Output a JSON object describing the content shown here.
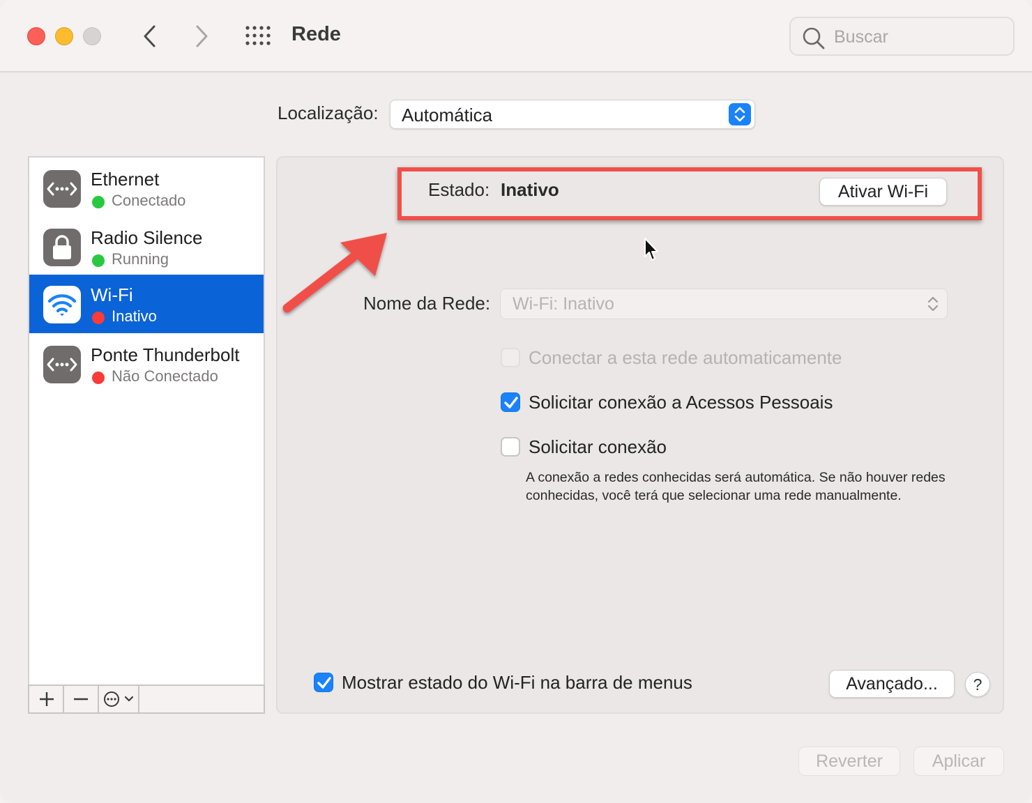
{
  "window": {
    "title": "Rede",
    "search_placeholder": "Buscar"
  },
  "location": {
    "label": "Localização:",
    "value": "Automática"
  },
  "services": [
    {
      "name": "Ethernet",
      "status": "Conectado",
      "status_color": "#28c941",
      "icon": "ethernet-icon"
    },
    {
      "name": "Radio Silence",
      "status": "Running",
      "status_color": "#28c941",
      "icon": "lock-icon"
    },
    {
      "name": "Wi-Fi",
      "status": "Inativo",
      "status_color": "#fb3b37",
      "icon": "wifi-icon",
      "selected": true
    },
    {
      "name": "Ponte Thunderbolt",
      "status": "Não Conectado",
      "status_color": "#fb3b37",
      "icon": "ethernet-icon"
    }
  ],
  "wifi": {
    "status_label": "Estado:",
    "status_value": "Inativo",
    "toggle_button": "Ativar Wi-Fi",
    "network_label": "Nome da Rede:",
    "network_value": "Wi-Fi: Inativo",
    "auto_join_label": "Conectar a esta rede automaticamente",
    "auto_join_checked": false,
    "ask_hotspot_label": "Solicitar conexão a Acessos Pessoais",
    "ask_hotspot_checked": true,
    "ask_join_label": "Solicitar conexão",
    "ask_join_checked": false,
    "ask_join_hint": "A conexão a redes conhecidas será automática. Se não houver redes conhecidas, você terá que selecionar uma rede manualmente.",
    "menubar_label": "Mostrar estado do Wi-Fi na barra de menus",
    "menubar_checked": true,
    "advanced_button": "Avançado...",
    "help_button": "?"
  },
  "footer": {
    "revert_button": "Reverter",
    "apply_button": "Aplicar"
  },
  "colors": {
    "accent": "#1a82fb",
    "selection": "#0b63d8",
    "annotation": "#f0504a"
  }
}
